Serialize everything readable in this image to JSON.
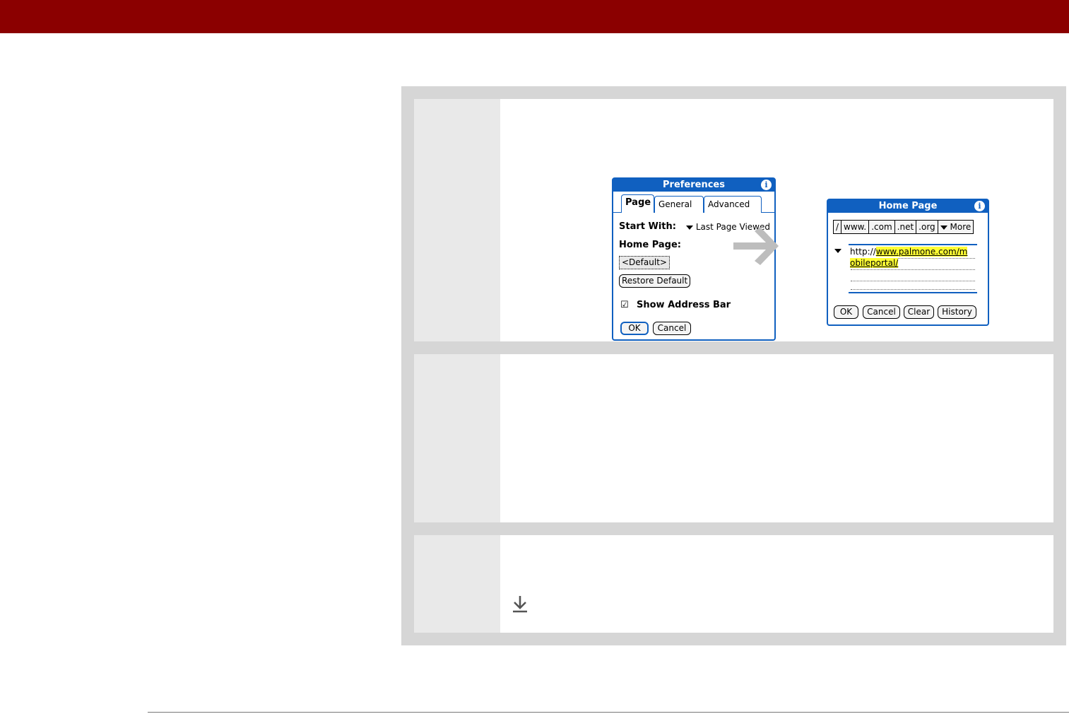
{
  "preferences_dialog": {
    "title": "Preferences",
    "info_icon": "i",
    "tabs": [
      {
        "label": "Page",
        "active": true
      },
      {
        "label": "General",
        "active": false
      },
      {
        "label": "Advanced",
        "active": false
      }
    ],
    "start_with_label": "Start With:",
    "start_with_value": "Last Page Viewed",
    "home_page_label": "Home Page:",
    "home_page_value": "<Default>",
    "restore_default_button": "Restore Default",
    "show_address_bar_check": "☑",
    "show_address_bar_label": "Show Address Bar",
    "ok_button": "OK",
    "cancel_button": "Cancel"
  },
  "home_page_dialog": {
    "title": "Home Page",
    "info_icon": "i",
    "shortcuts": [
      "/",
      "www.",
      ".com",
      ".net",
      ".org"
    ],
    "more_label": "More",
    "url_prefix": "http://",
    "url_highlight_1": "www.palmone.com/m",
    "url_highlight_2": "obileportal/",
    "buttons": [
      "OK",
      "Cancel",
      "Clear",
      "History"
    ]
  },
  "icons": {
    "arrow": "right-arrow-icon",
    "download": "download-arrow-icon",
    "dropdown": "triangle-down-icon",
    "info": "info-icon"
  },
  "colors": {
    "banner": "#8b0000",
    "palm_blue": "#1060c0",
    "highlight": "#ffff33"
  }
}
